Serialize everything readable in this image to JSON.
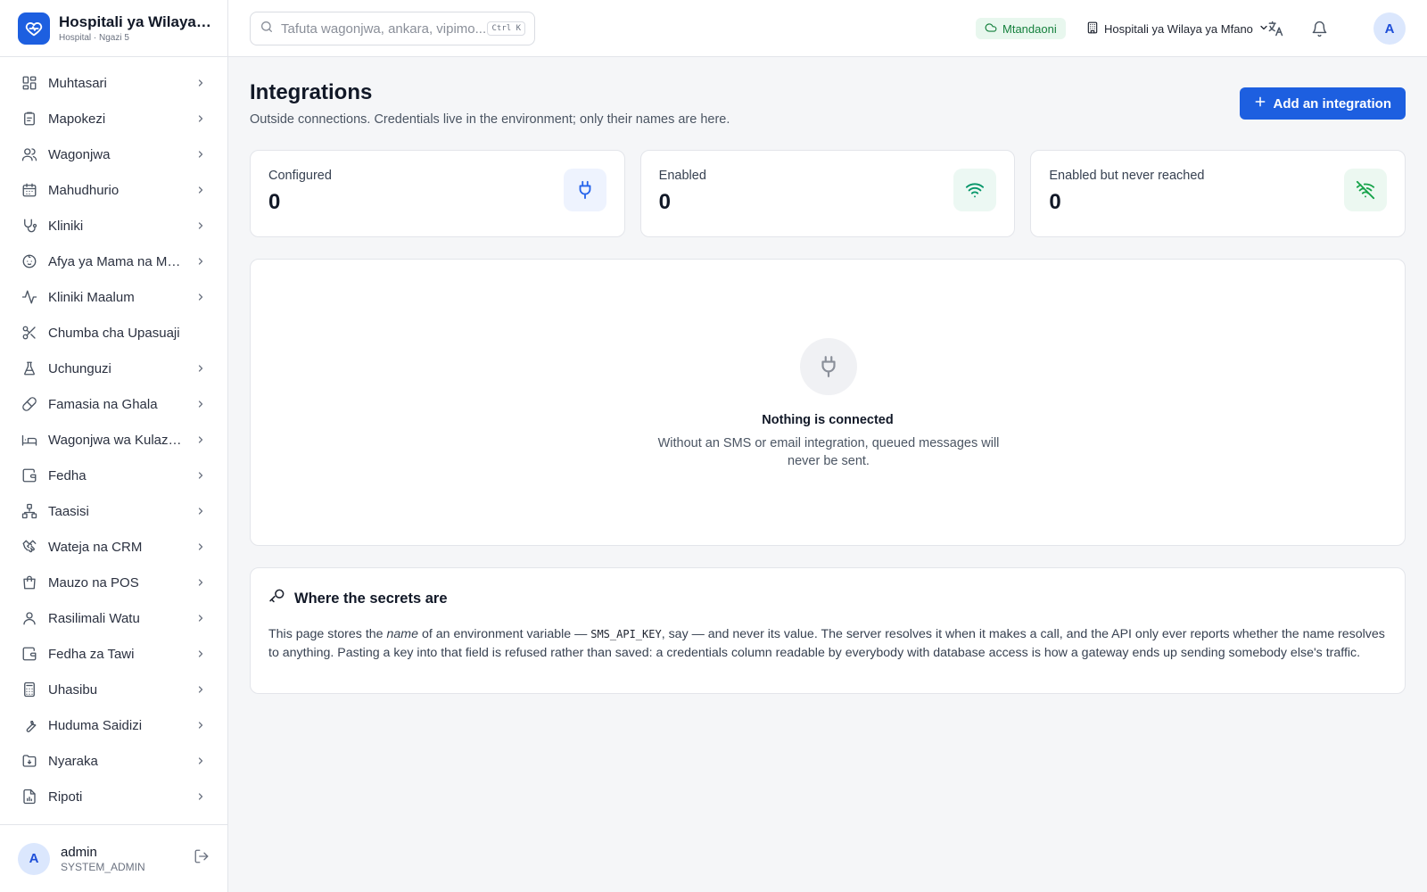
{
  "brand": {
    "title": "Hospitali ya Wilaya ya Mfano",
    "subtitle": "Hospital · Ngazi 5"
  },
  "sidebar": {
    "items": [
      {
        "label": "Muhtasari",
        "icon": "dashboard-icon",
        "has_chevron": true
      },
      {
        "label": "Mapokezi",
        "icon": "clipboard-icon",
        "has_chevron": true
      },
      {
        "label": "Wagonjwa",
        "icon": "users-icon",
        "has_chevron": true
      },
      {
        "label": "Mahudhurio",
        "icon": "calendar-icon",
        "has_chevron": true
      },
      {
        "label": "Kliniki",
        "icon": "stethoscope-icon",
        "has_chevron": true
      },
      {
        "label": "Afya ya Mama na Mtoto",
        "icon": "baby-icon",
        "has_chevron": true
      },
      {
        "label": "Kliniki Maalum",
        "icon": "activity-icon",
        "has_chevron": true
      },
      {
        "label": "Chumba cha Upasuaji",
        "icon": "scissors-icon",
        "has_chevron": false
      },
      {
        "label": "Uchunguzi",
        "icon": "flask-icon",
        "has_chevron": true
      },
      {
        "label": "Famasia na Ghala",
        "icon": "pill-icon",
        "has_chevron": true
      },
      {
        "label": "Wagonjwa wa Kulazwa",
        "icon": "bed-icon",
        "has_chevron": true
      },
      {
        "label": "Fedha",
        "icon": "wallet-icon",
        "has_chevron": true
      },
      {
        "label": "Taasisi",
        "icon": "network-icon",
        "has_chevron": true
      },
      {
        "label": "Wateja na CRM",
        "icon": "handshake-icon",
        "has_chevron": true
      },
      {
        "label": "Mauzo na POS",
        "icon": "shopping-bag-icon",
        "has_chevron": true
      },
      {
        "label": "Rasilimali Watu",
        "icon": "user-icon",
        "has_chevron": true
      },
      {
        "label": "Fedha za Tawi",
        "icon": "wallet-icon",
        "has_chevron": true
      },
      {
        "label": "Uhasibu",
        "icon": "calculator-icon",
        "has_chevron": true
      },
      {
        "label": "Huduma Saidizi",
        "icon": "wrench-icon",
        "has_chevron": true
      },
      {
        "label": "Nyaraka",
        "icon": "folder-icon",
        "has_chevron": true
      },
      {
        "label": "Ripoti",
        "icon": "report-icon",
        "has_chevron": true
      }
    ]
  },
  "user": {
    "initial": "A",
    "name": "admin",
    "role": "SYSTEM_ADMIN"
  },
  "topbar": {
    "search_placeholder": "Tafuta wagonjwa, ankara, vipimo...",
    "shortcut": "Ctrl K",
    "status": "Mtandaoni",
    "facility": "Hospitali ya Wilaya ya Mfano",
    "avatar_initial": "A"
  },
  "page": {
    "title": "Integrations",
    "subtitle": "Outside connections. Credentials live in the environment; only their names are here.",
    "add_button": "Add an integration"
  },
  "stats": [
    {
      "label": "Configured",
      "value": "0",
      "icon": "plug-icon",
      "color": "#2563eb",
      "bg": "#eef3fe"
    },
    {
      "label": "Enabled",
      "value": "0",
      "icon": "wifi-icon",
      "color": "#059669",
      "bg": "#ecf8f3"
    },
    {
      "label": "Enabled but never reached",
      "value": "0",
      "icon": "wifi-off-icon",
      "color": "#16a34a",
      "bg": "#ecf8f1"
    }
  ],
  "empty": {
    "title": "Nothing is connected",
    "text": "Without an SMS or email integration, queued messages will never be sent."
  },
  "secrets": {
    "title": "Where the secrets are",
    "p1": "This page stores the ",
    "em": "name",
    "p2": " of an environment variable — ",
    "code": "SMS_API_KEY",
    "p3": ", say — and never its value. The server resolves it when it makes a call, and the API only ever reports whether the name resolves to anything. Pasting a key into that field is refused rather than saved: a credentials column readable by everybody with database access is how a gateway ends up sending somebody else's traffic."
  },
  "colors": {
    "accent": "#1d5fe0",
    "online_text": "#15803d",
    "online_bg": "#e8f7ee"
  }
}
